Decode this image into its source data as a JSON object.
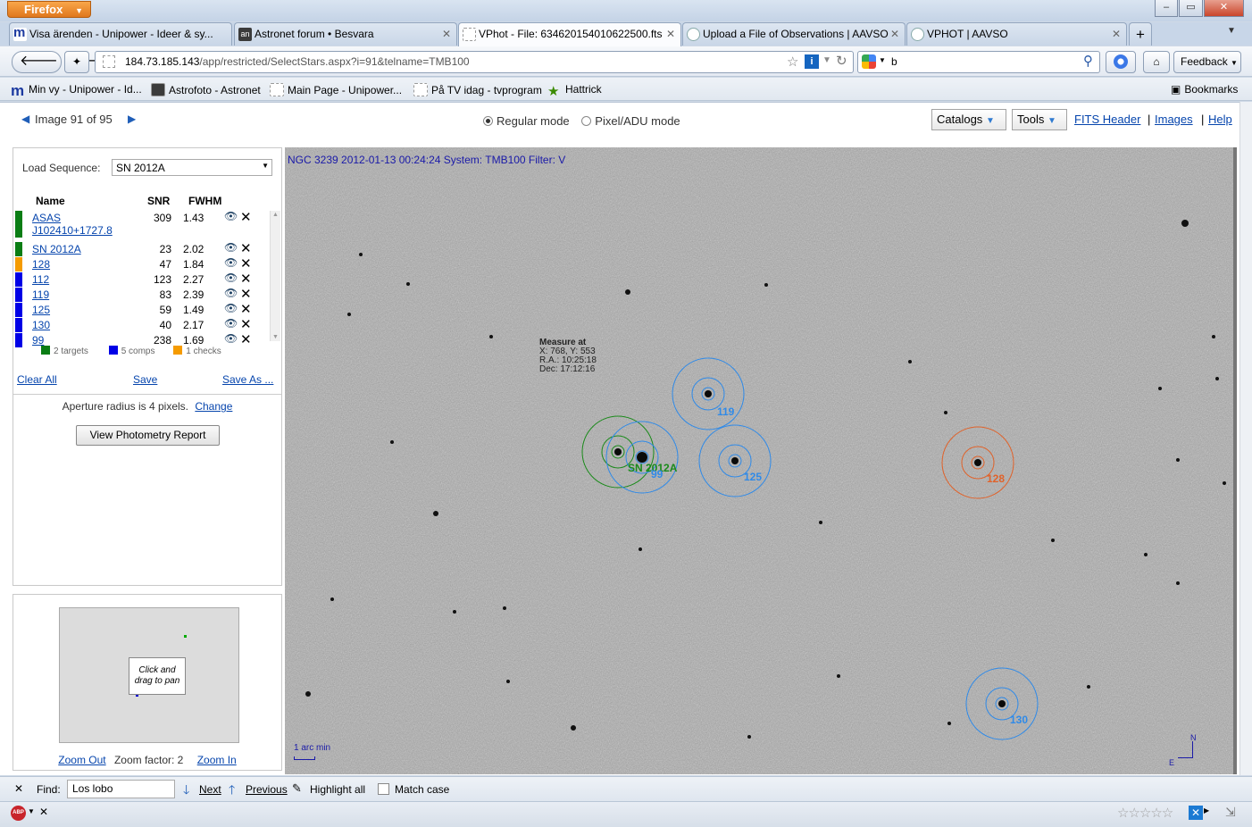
{
  "window": {
    "app_button": "Firefox",
    "controls": [
      "–",
      "▭",
      "✕"
    ]
  },
  "tabs": [
    {
      "label": "Visa ärenden - Unipower - Ideer & sy...",
      "active": false
    },
    {
      "label": "Astronet forum • Besvara",
      "active": false
    },
    {
      "label": "VPhot - File: 634620154010622500.fts",
      "active": true
    },
    {
      "label": "Upload a File of Observations | AAVSO",
      "active": false
    },
    {
      "label": "VPHOT | AAVSO",
      "active": false
    }
  ],
  "nav": {
    "url_host": "184.73.185.143",
    "url_path": "/app/restricted/SelectStars.aspx?i=91&telname=TMB100",
    "search_value": "b",
    "feedback_label": "Feedback"
  },
  "bookmarks": {
    "items": [
      "Min vy - Unipower - Id...",
      "Astrofoto - Astronet",
      "Main Page - Unipower...",
      "På TV idag - tvprogram",
      "Hattrick"
    ],
    "bookmarks_label": "Bookmarks"
  },
  "page": {
    "image_counter": "Image 91 of 95",
    "mode_regular": "Regular mode",
    "mode_pixel": "Pixel/ADU mode",
    "catalogs_label": "Catalogs",
    "tools_label": "Tools",
    "fits_header": "FITS Header",
    "images": "Images",
    "help": "Help",
    "separator": "|"
  },
  "sequence": {
    "label": "Load Sequence:",
    "selected": "SN 2012A",
    "col_name": "Name",
    "col_snr": "SNR",
    "col_fwhm": "FWHM",
    "rows": [
      {
        "name": "ASAS J102410+1727.8",
        "snr": "309",
        "fwhm": "1.43",
        "color": "#0a7d14"
      },
      {
        "name": "SN 2012A",
        "snr": "23",
        "fwhm": "2.02",
        "color": "#0a7d14"
      },
      {
        "name": "128",
        "snr": "47",
        "fwhm": "1.84",
        "color": "#f59b00"
      },
      {
        "name": "112",
        "snr": "123",
        "fwhm": "2.27",
        "color": "#0000e6"
      },
      {
        "name": "119",
        "snr": "83",
        "fwhm": "2.39",
        "color": "#0000e6"
      },
      {
        "name": "125",
        "snr": "59",
        "fwhm": "1.49",
        "color": "#0000e6"
      },
      {
        "name": "130",
        "snr": "40",
        "fwhm": "2.17",
        "color": "#0000e6"
      },
      {
        "name": "99",
        "snr": "238",
        "fwhm": "1.69",
        "color": "#0000e6"
      }
    ],
    "legend": [
      {
        "label": "2 targets",
        "color": "#0a7d14"
      },
      {
        "label": "5 comps",
        "color": "#0000e6"
      },
      {
        "label": "1 checks",
        "color": "#f59b00"
      }
    ],
    "clear_all": "Clear All",
    "save": "Save",
    "save_as": "Save As ...",
    "aperture_text": "Aperture radius is 4 pixels.",
    "change": "Change",
    "report_button": "View Photometry Report"
  },
  "minimap": {
    "hint": "Click and drag to pan",
    "zoom_out": "Zoom Out",
    "zoom_factor_label": "Zoom factor:",
    "zoom_factor": "2",
    "zoom_in": "Zoom In"
  },
  "image": {
    "caption": "NGC 3239 2012-01-13 00:24:24 System: TMB100 Filter: V",
    "measure_title": "Measure at",
    "measure_xy": "X: 768, Y: 553",
    "measure_ra": "R.A.: 10:25:18",
    "measure_dec": "Dec: 17:12:16",
    "scale_label": "1 arc min",
    "compass_n": "N",
    "compass_e": "E",
    "labels": {
      "sn": "SN 2012A",
      "c99": "99",
      "c119": "119",
      "c125": "125",
      "c128": "128",
      "c130": "130"
    },
    "colors": {
      "target": "#1a8a1a",
      "comp": "#2f8ae8",
      "check": "#e0622a"
    }
  },
  "findbar": {
    "label": "Find:",
    "value": "Los lobo",
    "next": "Next",
    "previous": "Previous",
    "highlight_all": "Highlight all",
    "match_case": "Match case"
  }
}
